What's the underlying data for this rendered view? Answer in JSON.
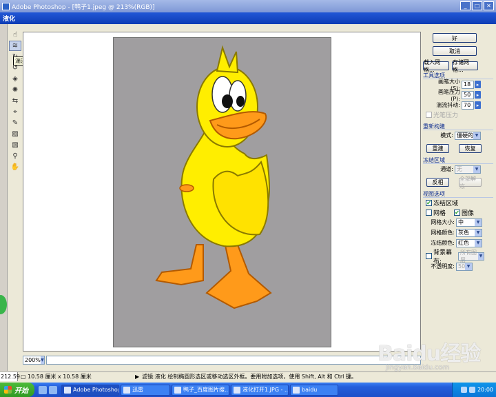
{
  "app": {
    "window_title": "Adobe Photoshop - [鸭子1.jpeg @ 213%(RGB)]"
  },
  "dialog": {
    "title": "液化"
  },
  "toolbar": {
    "tools": [
      {
        "icon": "warp-tool-icon"
      },
      {
        "icon": "turbulence-tool-icon"
      },
      {
        "icon": "twirl-clockwise-icon"
      },
      {
        "icon": "twirl-counterclockwise-icon"
      },
      {
        "icon": "pucker-tool-icon"
      },
      {
        "icon": "bloat-tool-icon"
      },
      {
        "icon": "shift-pixels-icon"
      },
      {
        "icon": "reflection-tool-icon"
      },
      {
        "icon": "reconstruct-tool-icon"
      },
      {
        "icon": "freeze-mask-icon"
      },
      {
        "icon": "thaw-mask-icon"
      },
      {
        "icon": "zoom-tool-icon"
      },
      {
        "icon": "hand-tool-icon"
      }
    ],
    "tooltip": "湍流工具(A)"
  },
  "zoom": {
    "value": "200%"
  },
  "panel": {
    "ok_label": "好",
    "cancel_label": "取消",
    "load_mesh_label": "载入网格...",
    "save_mesh_label": "存储网格...",
    "tool_options": {
      "title": "工具选项",
      "brush_size_label": "画笔大小(S):",
      "brush_size_value": "18",
      "brush_pressure_label": "画笔压力(P):",
      "brush_pressure_value": "50",
      "turbulent_jitter_label": "湍流抖动:",
      "turbulent_jitter_value": "70",
      "stylus_label": "光笔压力"
    },
    "reconstruct": {
      "title": "重新构建",
      "mode_label": "模式:",
      "mode_value": "僵硬的",
      "reconstruct_label": "重建",
      "revert_label": "恢复"
    },
    "freeze": {
      "title": "冻结区域",
      "channel_label": "通道:",
      "channel_value": "无",
      "invert_label": "反相",
      "thaw_all_label": "全部解冻"
    },
    "view": {
      "title": "视图选项",
      "frozen_areas_label": "冻结区域",
      "mesh_label": "网格",
      "image_label": "图像",
      "mesh_size_label": "网格大小:",
      "mesh_size_value": "中",
      "mesh_color_label": "网格颜色:",
      "mesh_color_value": "灰色",
      "freeze_color_label": "冻结颜色:",
      "freeze_color_value": "红色",
      "backdrop_label": "背景幕布:",
      "backdrop_value": "所有图层",
      "opacity_label": "不透明度:",
      "opacity_value": "50"
    }
  },
  "statusbar": {
    "zoom": "212.59",
    "doc_size": "10.58 厘米 x 10.58 厘米",
    "message": "滤镜:液化  绘制椭圆形选区或移动选区外框。要用附加选项，使用 Shift, Alt 和 Ctrl 键。"
  },
  "taskbar": {
    "start_label": "开始",
    "tasks": [
      {
        "label": "Adobe Photoshop ..."
      },
      {
        "label": "迅雷"
      },
      {
        "label": "鸭子_百度图片搜..."
      },
      {
        "label": "液化打开1.JPG - ..."
      },
      {
        "label": "baidu"
      }
    ],
    "clock": "20:00"
  },
  "watermark": {
    "brand": "Baidu经验",
    "url": "jingyan.baidu.com"
  },
  "colors": {
    "duck_body": "#ffee00",
    "duck_beak": "#ff9a1a",
    "canvas_bg": "#a09ea0",
    "xp_blue": "#245edb"
  }
}
